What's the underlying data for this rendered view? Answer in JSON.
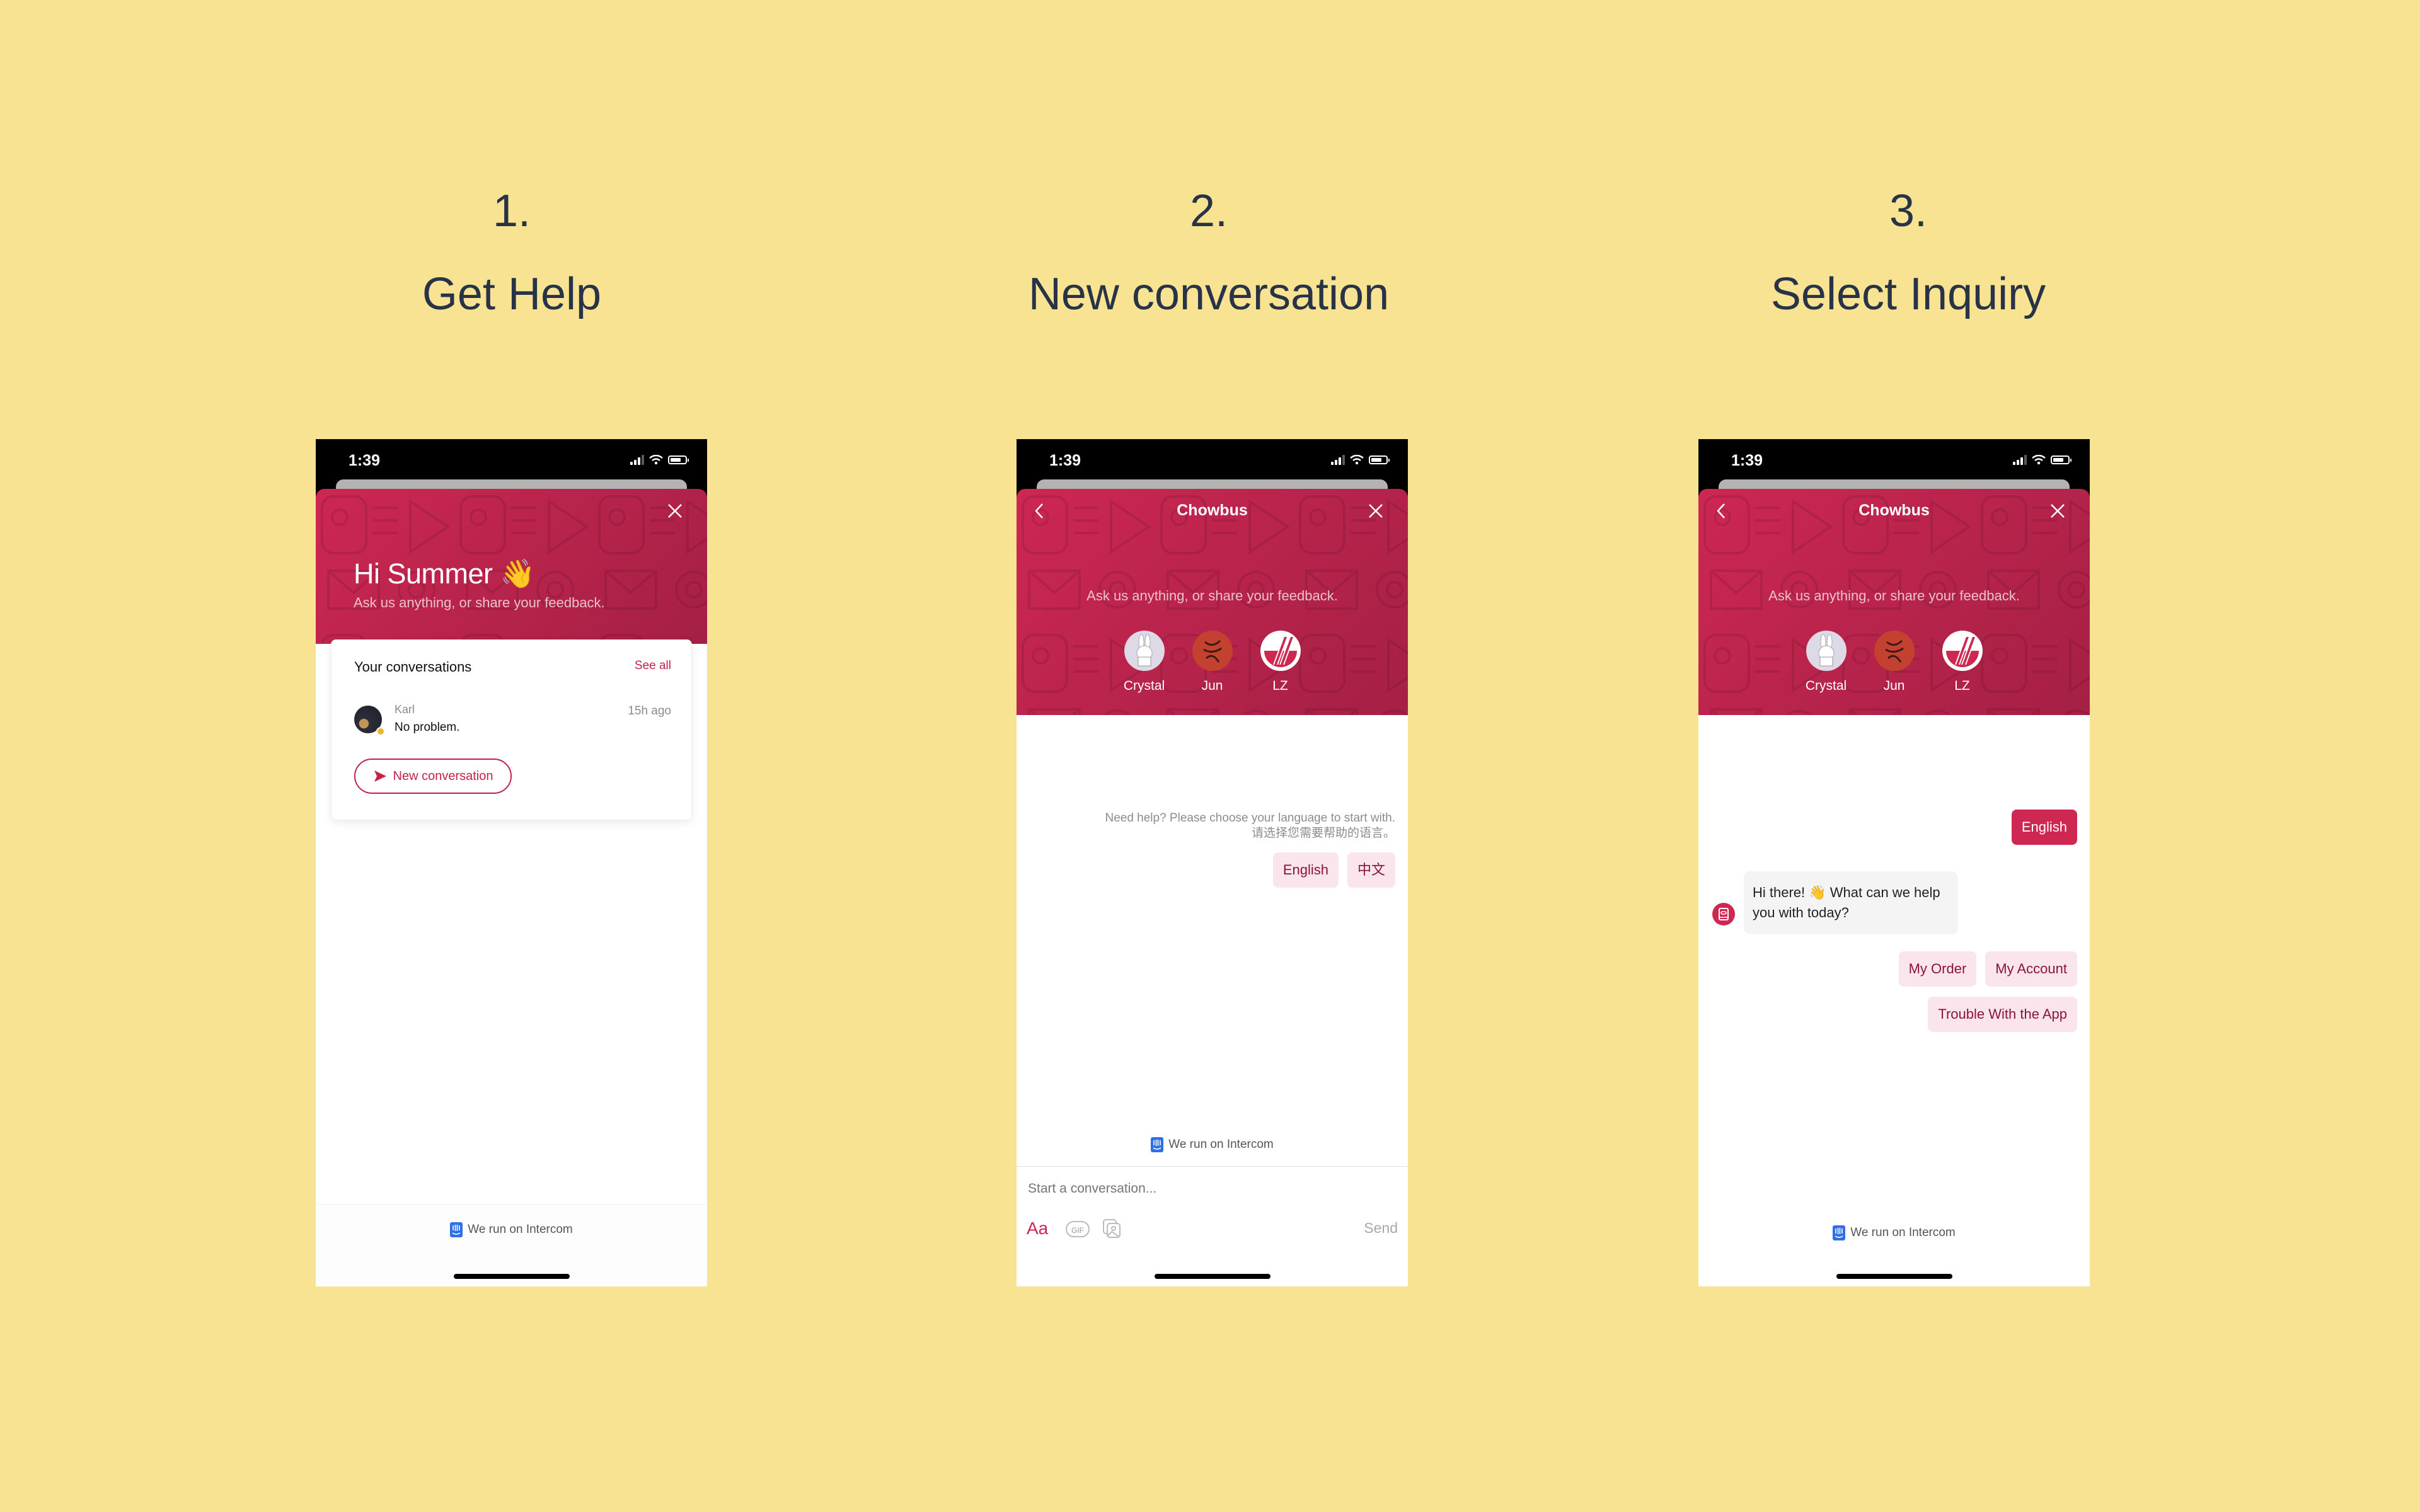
{
  "steps": [
    {
      "number": "1.",
      "title": "Get Help"
    },
    {
      "number": "2.",
      "title": "New conversation"
    },
    {
      "number": "3.",
      "title": "Select Inquiry"
    }
  ],
  "status_bar": {
    "time": "1:39"
  },
  "colors": {
    "background": "#f8e393",
    "brand": "#cd2752",
    "reply_bg": "#fbe5ec",
    "reply_text": "#8b1438",
    "intercom": "#2f6fe4"
  },
  "screen1": {
    "greeting": "Hi Summer 👋",
    "subtitle": "Ask us anything, or share your feedback.",
    "conversations": {
      "heading": "Your conversations",
      "see_all": "See all",
      "items": [
        {
          "name": "Karl",
          "message": "No problem.",
          "time": "15h ago"
        }
      ]
    },
    "new_conversation_label": "New conversation",
    "footer": "We run on Intercom"
  },
  "screen2": {
    "title": "Chowbus",
    "subtitle": "Ask us anything, or share your feedback.",
    "team": [
      {
        "name": "Crystal"
      },
      {
        "name": "Jun"
      },
      {
        "name": "LZ"
      }
    ],
    "prompt_line1": "Need help? Please choose your language to start with.",
    "prompt_line2": "请选择您需要帮助的语言。",
    "language_options": [
      "English",
      "中文"
    ],
    "footer": "We run on Intercom",
    "composer": {
      "placeholder": "Start a conversation...",
      "format_label": "Aa",
      "gif_label": "GIF",
      "send_label": "Send"
    }
  },
  "screen3": {
    "title": "Chowbus",
    "subtitle": "Ask us anything, or share your feedback.",
    "team": [
      {
        "name": "Crystal"
      },
      {
        "name": "Jun"
      },
      {
        "name": "LZ"
      }
    ],
    "user_reply": "English",
    "bot_message": "Hi there! 👋 What can we help you with today?",
    "inquiry_options": [
      "My Order",
      "My Account",
      "Trouble With the App"
    ],
    "footer": "We run on Intercom"
  }
}
